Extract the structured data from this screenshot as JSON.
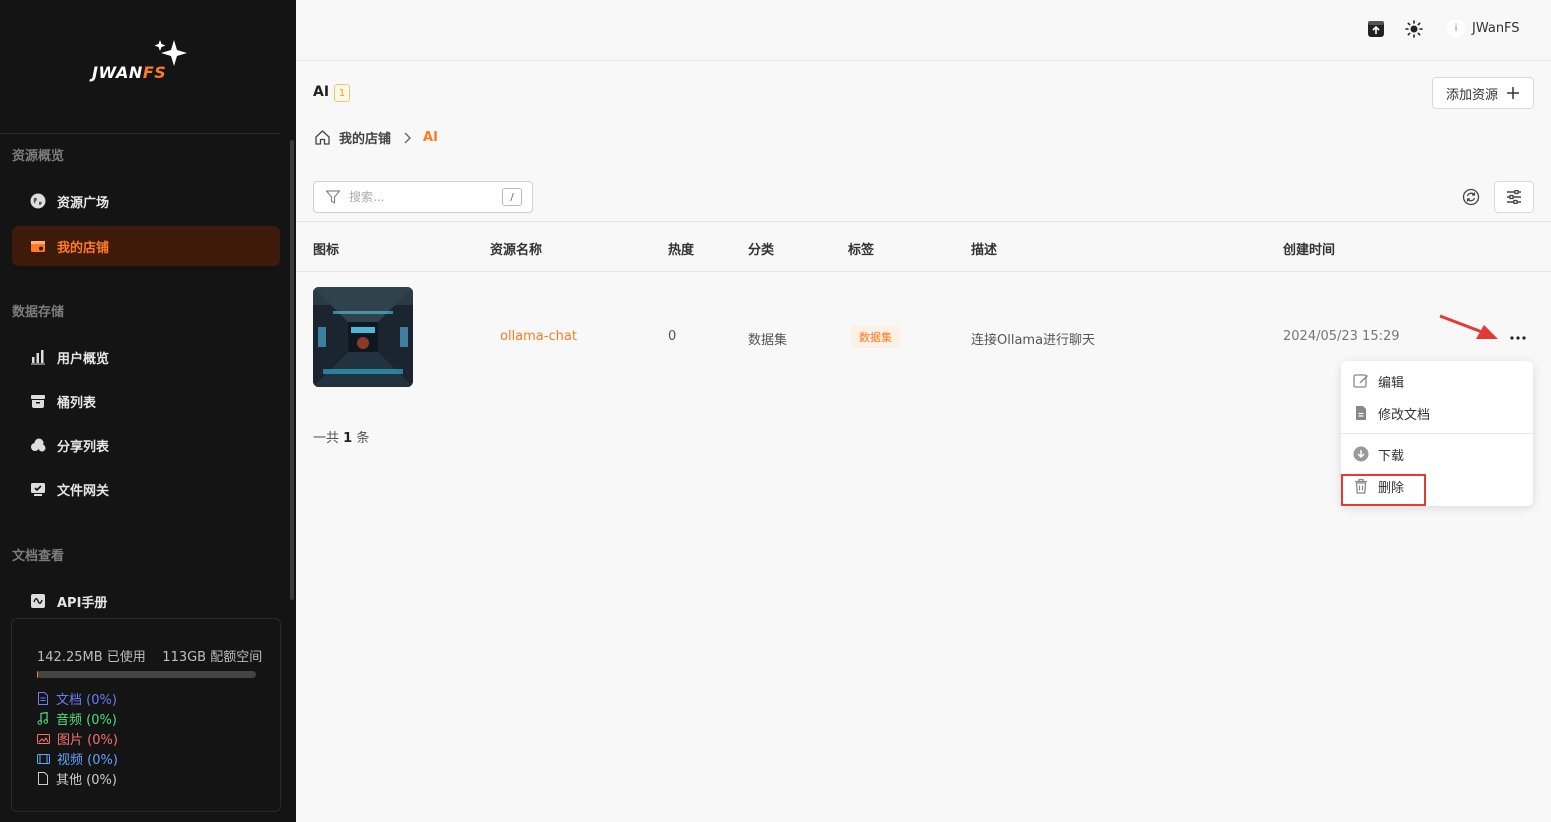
{
  "brand": {
    "logo_main": "JWAN",
    "logo_accent": "FS"
  },
  "sidebar": {
    "groups": [
      {
        "title": "资源概览"
      },
      {
        "title": "数据存储"
      },
      {
        "title": "文档查看"
      }
    ],
    "items": [
      {
        "label": "资源广场",
        "icon": "globe-icon"
      },
      {
        "label": "我的店铺",
        "icon": "store-icon",
        "active": true
      },
      {
        "label": "用户概览",
        "icon": "bar-chart-icon"
      },
      {
        "label": "桶列表",
        "icon": "bucket-icon"
      },
      {
        "label": "分享列表",
        "icon": "cloud-icon"
      },
      {
        "label": "文件网关",
        "icon": "gateway-icon"
      },
      {
        "label": "API手册",
        "icon": "api-icon"
      }
    ],
    "storage": {
      "used": "142.25MB 已使用",
      "quota": "113GB 配额空间",
      "used_fraction": 0.0012,
      "categories": [
        {
          "label": "文档 (0%)",
          "color": "#6b7cf6",
          "icon": "document-icon"
        },
        {
          "label": "音频 (0%)",
          "color": "#4ade80",
          "icon": "music-icon"
        },
        {
          "label": "图片 (0%)",
          "color": "#f87171",
          "icon": "image-icon"
        },
        {
          "label": "视频 (0%)",
          "color": "#60a5fa",
          "icon": "video-icon"
        },
        {
          "label": "其他 (0%)",
          "color": "#cccccc",
          "icon": "file-icon"
        }
      ]
    }
  },
  "header": {
    "user_initial": "i",
    "user_name": "JWanFS"
  },
  "main": {
    "title": "AI",
    "count": "1",
    "add_button": "添加资源",
    "breadcrumb": {
      "home": "我的店铺",
      "current": "AI"
    },
    "search": {
      "placeholder": "搜索...",
      "shortcut": "/"
    },
    "table": {
      "columns": [
        "图标",
        "资源名称",
        "热度",
        "分类",
        "标签",
        "描述",
        "创建时间"
      ],
      "rows": [
        {
          "name": "ollama-chat",
          "heat": "0",
          "category": "数据集",
          "tag": "数据集",
          "description": "连接Ollama进行聊天",
          "created": "2024/05/23 15:29"
        }
      ]
    },
    "total": {
      "prefix": "一共",
      "count": "1",
      "suffix": "条"
    },
    "context_menu": {
      "edit": "编辑",
      "edit_doc": "修改文档",
      "download": "下载",
      "delete": "删除"
    }
  },
  "colors": {
    "accent": "#ff7a20",
    "sidebar_bg": "#141414",
    "annotation": "#e53935"
  }
}
